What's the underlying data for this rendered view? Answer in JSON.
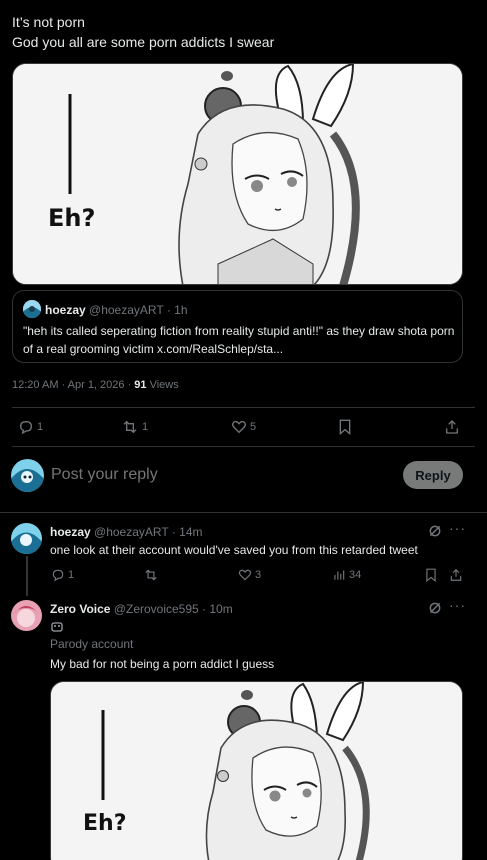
{
  "tweet": {
    "line1": "It’s not porn",
    "line2": "God you all are some porn addicts I swear",
    "image_alt_text": "Eh?",
    "quote": {
      "name": "hoezay",
      "handle": "@hoezayART",
      "sep": "·",
      "time": "1h",
      "text": "\"heh its called seperating fiction from reality stupid anti!!\" as they draw shota porn of a real grooming victim x.com/RealSchlep/sta..."
    },
    "meta": {
      "time_date": "12:20 AM · Apr 1, 2026 · ",
      "views_count": "91",
      "views_label": " Views"
    },
    "actions": {
      "replies": "1",
      "reposts": "1",
      "likes": "5"
    }
  },
  "composer": {
    "placeholder": "Post your reply",
    "button": "Reply"
  },
  "replies": [
    {
      "name": "hoezay",
      "handle": "@hoezayART",
      "time": "· 14m",
      "text": "one look at their account would've saved you from this retarded tweet",
      "replies": "1",
      "likes": "3",
      "views": "34"
    },
    {
      "name": "Zero Voice",
      "handle": "@Zerovoice595",
      "time": "· 10m",
      "badge": "Parody account",
      "text": "My bad for not being a porn addict I guess",
      "image_alt_text": "Eh?"
    }
  ],
  "colors": {
    "background": "#000000",
    "text": "#e7e9ea",
    "muted": "#71767b",
    "border": "#2f3336"
  }
}
